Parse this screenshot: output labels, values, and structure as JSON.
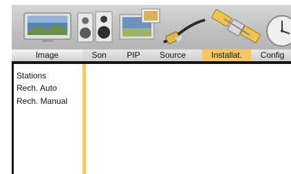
{
  "tabs": {
    "image": "Image",
    "son": "Son",
    "pip": "PIP",
    "source": "Source",
    "installation": "Installat.",
    "config": "Config"
  },
  "active_tab": "installation",
  "menu": {
    "items": [
      "Stations",
      "Rech. Auto",
      "Rech. Manual"
    ]
  },
  "colors": {
    "accent": "#f7c766",
    "border": "#111111",
    "band": "#c4c4c4"
  },
  "icons": [
    "tv-icon",
    "speakers-icon",
    "pip-icon",
    "cable-icon",
    "satellite-icon",
    "clock-icon"
  ]
}
